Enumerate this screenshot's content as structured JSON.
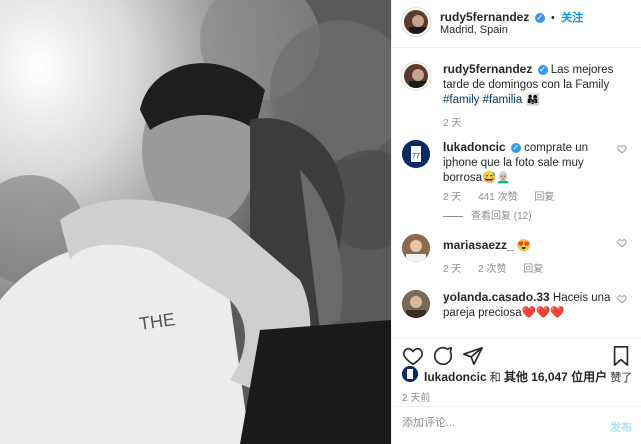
{
  "post": {
    "author": "rudy5fernandez",
    "follow_label": "关注",
    "separator": "•",
    "location": "Madrid, Spain",
    "photo_alt": "photo"
  },
  "caption": {
    "username": "rudy5fernandez",
    "text": "Las mejores tarde de domingos con la Family",
    "hashtags": "#family #familia",
    "emoji": "👨‍👩‍👧",
    "time": "2 天"
  },
  "comments": [
    {
      "username": "lukadoncic",
      "verified": true,
      "text": "comprate un iphone que la foto sale muy borrosa",
      "emoji": "😅👨🏼‍🦳",
      "time": "2 天",
      "likes": "441 次赞",
      "reply_label": "回复",
      "view_replies": "查看回复 (12)"
    },
    {
      "username": "mariasaezz_",
      "verified": false,
      "text": "",
      "emoji": "😍",
      "time": "2 天",
      "likes": "2 次赞",
      "reply_label": "回复"
    },
    {
      "username": "yolanda.casado.33",
      "verified": false,
      "text": "Haceis una pareja preciosa",
      "emoji": "❤️❤️❤️"
    }
  ],
  "likes": {
    "user": "lukadoncic",
    "conjunction": "和",
    "others": "其他 16,047 位用户",
    "suffix": "赞了"
  },
  "post_time": "2 天前",
  "add_comment": {
    "placeholder": "添加评论...",
    "post_label": "发布"
  },
  "icons": [
    "heart-icon",
    "comment-icon",
    "share-icon",
    "bookmark-icon",
    "verified-icon"
  ],
  "colors": {
    "link": "#0095f6",
    "verified": "#3897f0",
    "hashtag": "#00376b",
    "muted": "#8e8e8e"
  }
}
